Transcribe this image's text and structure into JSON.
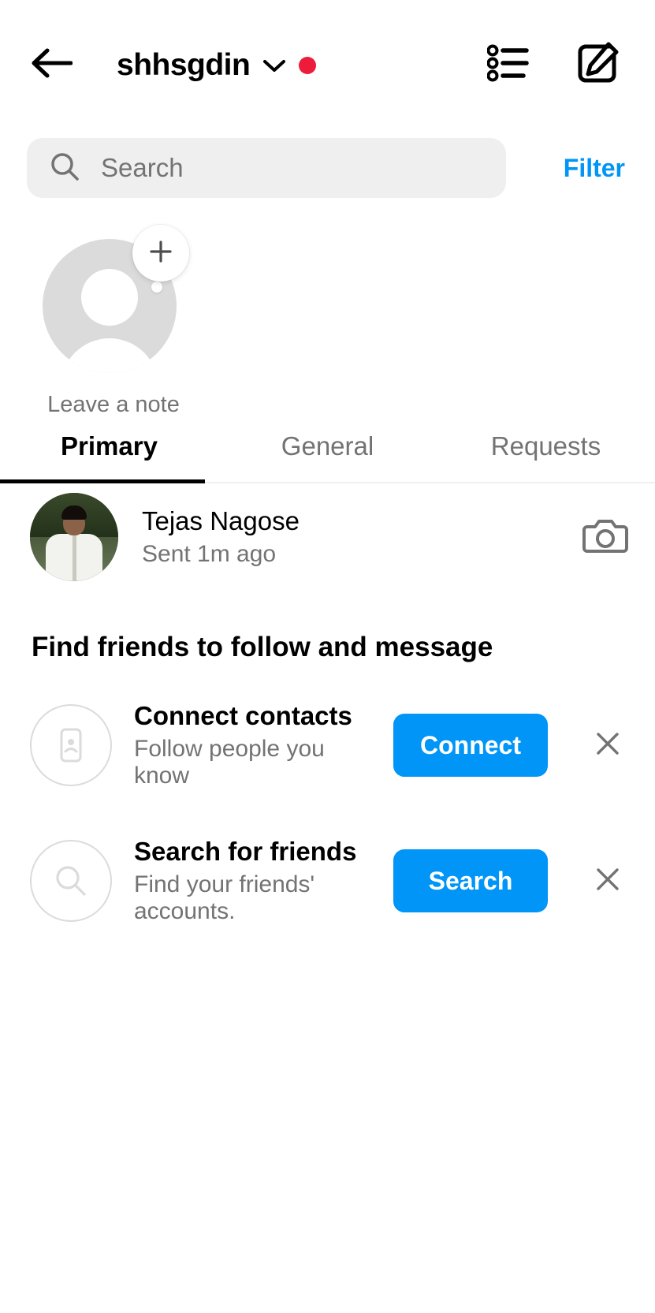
{
  "header": {
    "back_icon": "back-arrow-icon",
    "username": "shhsgdin",
    "chevron_icon": "chevron-down-icon",
    "unread_dot": "red-dot-indicator",
    "threads_icon": "threads-list-icon",
    "compose_icon": "compose-message-icon",
    "highlight_color": "#E8384F"
  },
  "search": {
    "icon": "search-icon",
    "placeholder": "Search",
    "value": "",
    "filter_label": "Filter",
    "filter_color": "#0095F6"
  },
  "note": {
    "avatar_icon": "default-avatar-icon",
    "plus_icon": "plus-icon",
    "label": "Leave a note"
  },
  "tabs": [
    {
      "label": "Primary",
      "active": true
    },
    {
      "label": "General",
      "active": false
    },
    {
      "label": "Requests",
      "active": false
    }
  ],
  "threads": [
    {
      "name": "Tejas Nagose",
      "status": "Sent 1m ago",
      "avatar": "user-photo-avatar",
      "action_icon": "camera-icon"
    }
  ],
  "find_friends": {
    "heading": "Find friends to follow and message",
    "items": [
      {
        "icon": "contact-card-icon",
        "title": "Connect contacts",
        "subtitle": "Follow people you know",
        "button_label": "Connect",
        "dismiss_icon": "close-icon"
      },
      {
        "icon": "search-circle-icon",
        "title": "Search for friends",
        "subtitle": "Find your friends' accounts.",
        "button_label": "Search",
        "dismiss_icon": "close-icon"
      }
    ]
  },
  "colors": {
    "accent_blue": "#0095F6",
    "highlight_red": "#E8384F",
    "notification_red": "#ED1C3A",
    "search_bg": "#EFEFEF",
    "secondary_text": "#737373"
  }
}
